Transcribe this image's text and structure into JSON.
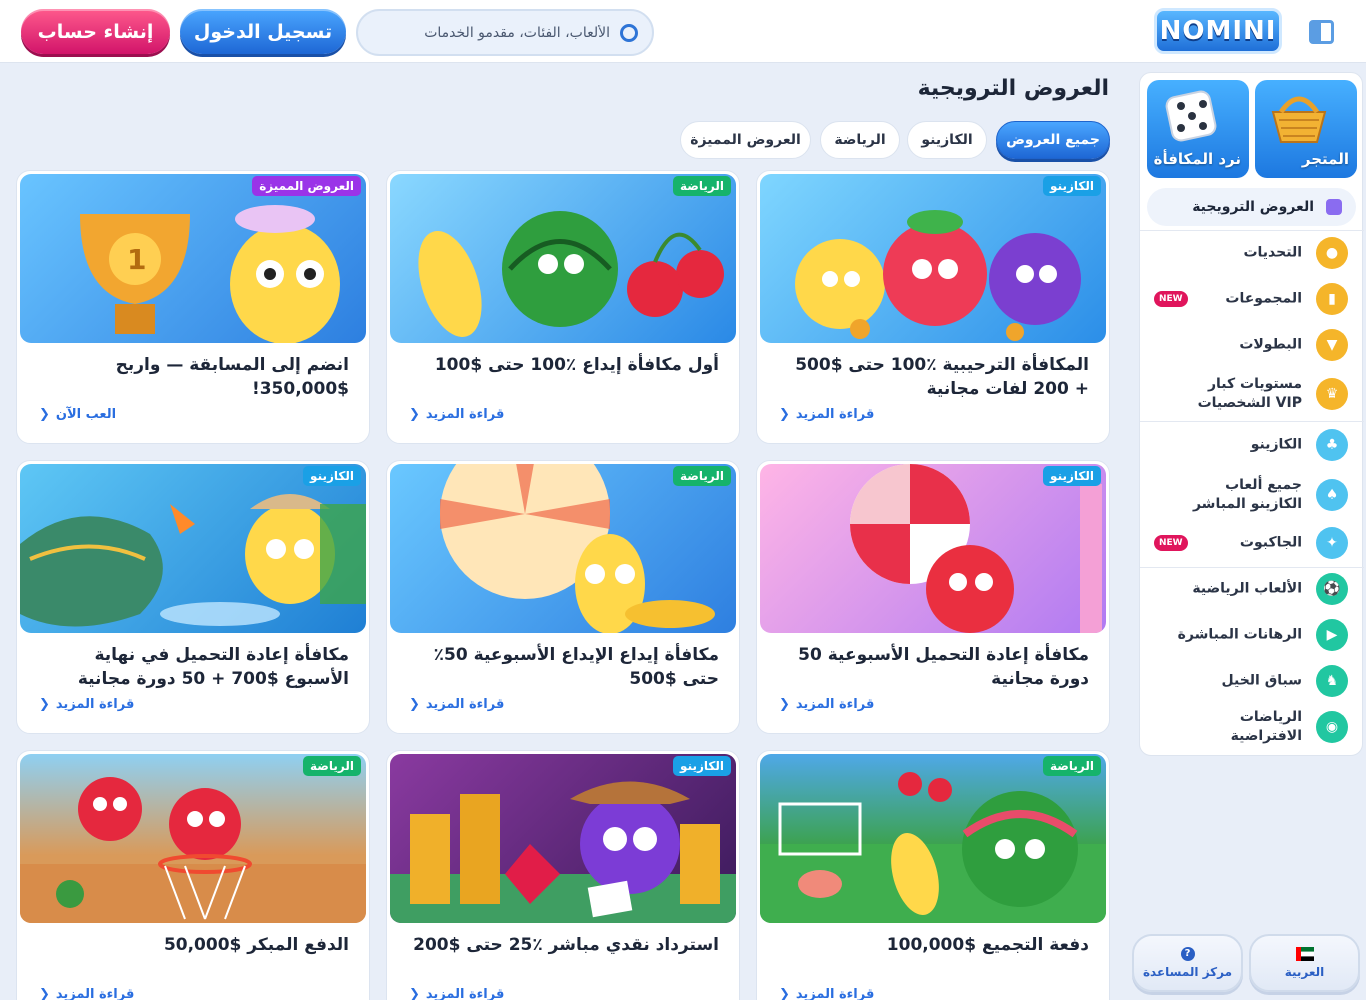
{
  "header": {
    "logo_text": "NOMINI",
    "search_placeholder": "الألعاب، الفئات، مقدمو الخدمات",
    "login_label": "تسجيل الدخول",
    "signup_label": "إنشاء حساب"
  },
  "sidebar": {
    "tiles": [
      {
        "label": "المتجر",
        "icon": "basket-icon"
      },
      {
        "label": "نرد المكافأة",
        "icon": "dice-icon"
      }
    ],
    "promo_item": "العروض الترويجية",
    "items": [
      {
        "label": "التحديات",
        "icon": "challenge-icon",
        "color": "#f5b52a"
      },
      {
        "label": "المجموعات",
        "icon": "cards-icon",
        "color": "#f5b52a",
        "badge": "NEW"
      },
      {
        "label": "البطولات",
        "icon": "trophy-icon",
        "color": "#f5b52a"
      },
      {
        "label": "مستويات كبار الشخصيات VIP",
        "icon": "crown-icon",
        "color": "#f5b52a"
      },
      {
        "label": "الكازينو",
        "icon": "casino-icon",
        "color": "#4fc3f0"
      },
      {
        "label": "جميع ألعاب الكازينو المباشر",
        "icon": "live-casino-icon",
        "color": "#4fc3f0"
      },
      {
        "label": "الجاكبوت",
        "icon": "jackpot-icon",
        "color": "#4fc3f0",
        "badge": "NEW"
      },
      {
        "label": "الألعاب الرياضية",
        "icon": "football-icon",
        "color": "#21c7a1"
      },
      {
        "label": "الرهانات المباشرة",
        "icon": "live-bet-icon",
        "color": "#21c7a1"
      },
      {
        "label": "سباق الخيل",
        "icon": "horse-icon",
        "color": "#21c7a1"
      },
      {
        "label": "الرياضات الافتراضية",
        "icon": "virtual-sport-icon",
        "color": "#21c7a1"
      }
    ]
  },
  "main": {
    "title": "العروض الترويجية",
    "tabs": [
      "جميع العروض",
      "الكازينو",
      "الرياضة",
      "العروض المميزة"
    ],
    "cards": [
      {
        "badge": "الكازينو",
        "badge_color": "#1aa0e6",
        "title": "المكافأة الترحيبية ٪100 حتى $500 + 200 لفات مجانية",
        "link": "قراءة المزيد"
      },
      {
        "badge": "الرياضة",
        "badge_color": "#16b36b",
        "title": "أول مكافأة إيداع ٪100 حتى $100",
        "link": "قراءة المزيد"
      },
      {
        "badge": "العروض المميزة",
        "badge_color": "#9a34e8",
        "title": "انضم إلى المسابقة — واربح $350,000!",
        "link": "العب الآن"
      },
      {
        "badge": "الكازينو",
        "badge_color": "#1aa0e6",
        "title": "مكافأة إعادة التحميل الأسبوعية 50 دورة مجانية",
        "link": "قراءة المزيد"
      },
      {
        "badge": "الرياضة",
        "badge_color": "#16b36b",
        "title": "مكافأة إيداع الإيداع الأسبوعية 50٪ حتى $500",
        "link": "قراءة المزيد"
      },
      {
        "badge": "الكازينو",
        "badge_color": "#1aa0e6",
        "title": "مكافأة إعادة التحميل في نهاية الأسبوع $700 + 50 دورة مجانية",
        "link": "قراءة المزيد"
      },
      {
        "badge": "الرياضة",
        "badge_color": "#16b36b",
        "title": "دفعة التجميع $100,000",
        "link": "قراءة المزيد"
      },
      {
        "badge": "الكازينو",
        "badge_color": "#1aa0e6",
        "title": "استرداد نقدي مباشر ٪25 حتى $200",
        "link": "قراءة المزيد"
      },
      {
        "badge": "الرياضة",
        "badge_color": "#16b36b",
        "title": "الدفع المبكر $50,000",
        "link": "قراءة المزيد"
      }
    ]
  },
  "footer": {
    "language_label": "العربية",
    "help_label": "مركز المساعدة"
  }
}
